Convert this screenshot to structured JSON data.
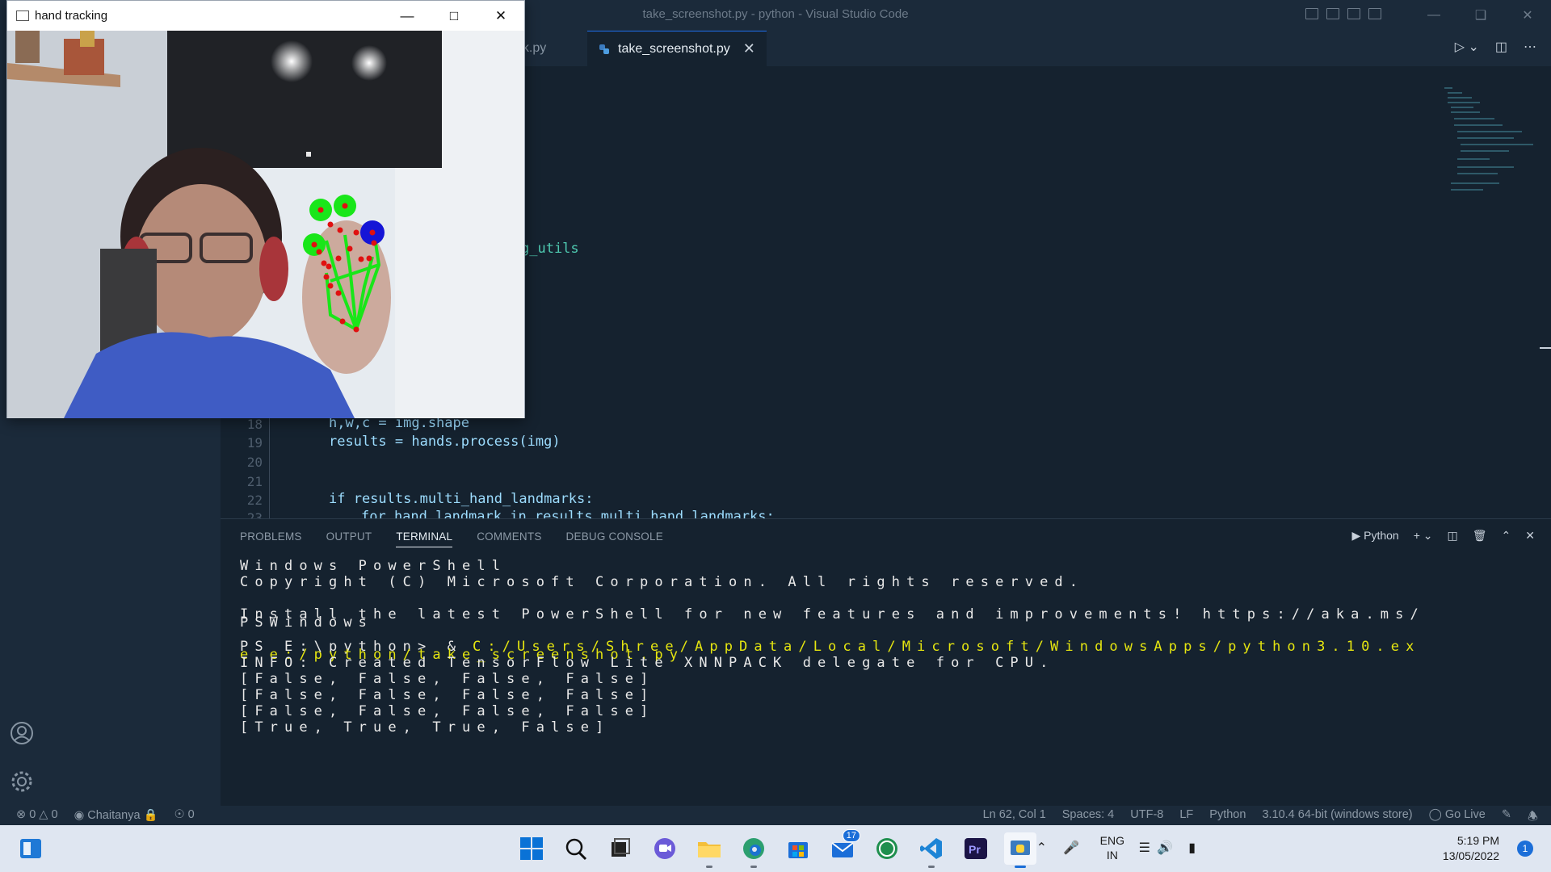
{
  "window": {
    "title": "take_screenshot.py - python - Visual Studio Code"
  },
  "editor": {
    "tabs": [
      {
        "label": "ask.py"
      },
      {
        "label": "take_screenshot.py",
        "active": true
      }
    ],
    "code_fragment": "g_utils",
    "lines": [
      {
        "num": "18",
        "text": "h,w,c = img.shape"
      },
      {
        "num": "19",
        "text": "results = hands.process(img)"
      },
      {
        "num": "20",
        "text": ""
      },
      {
        "num": "21",
        "text": ""
      },
      {
        "num": "22",
        "text": "if results.multi_hand_landmarks:"
      },
      {
        "num": "23",
        "text": "for hand_landmark in results.multi_hand_landmarks:"
      }
    ]
  },
  "panel": {
    "tabs": [
      "PROBLEMS",
      "OUTPUT",
      "TERMINAL",
      "COMMENTS",
      "DEBUG CONSOLE"
    ],
    "active_tab": "TERMINAL",
    "shell_label": "Python",
    "terminal_lines": [
      "Windows PowerShell",
      "Copyright (C) Microsoft Corporation. All rights reserved.",
      "Install the latest PowerShell for new features and improvements! https://aka.ms/",
      "PSWindows",
      "PS E:\\python> & ",
      "C:/Users/Shree/AppData/Local/Microsoft/WindowsApps/python3.10.ex",
      "e e:/python/take_screenshot.py",
      "INFO: Created TensorFlow Lite XNNPACK delegate for CPU.",
      "[False, False, False, False]",
      "[False, False, False, False]",
      "[False, False, False, False]",
      "[True, True, True, False]"
    ]
  },
  "statusbar": {
    "errors": "0",
    "warnings": "0",
    "user": "Chaitanya",
    "ports": "0",
    "position": "Ln 62, Col 1",
    "spaces": "Spaces: 4",
    "encoding": "UTF-8",
    "eol": "LF",
    "language": "Python",
    "interpreter": "3.10.4 64-bit (windows store)",
    "golive": "Go Live"
  },
  "taskbar": {
    "badge": "17",
    "lang1": "ENG",
    "lang2": "IN",
    "time": "5:19 PM",
    "date": "13/05/2022",
    "notif": "1"
  },
  "overlay": {
    "title": "hand tracking"
  },
  "colors": {
    "accent": "#1f6feb",
    "terminal_yellow": "#e5e510",
    "editor_bg": "#15222f",
    "chrome_bg": "#1b2a3a"
  }
}
